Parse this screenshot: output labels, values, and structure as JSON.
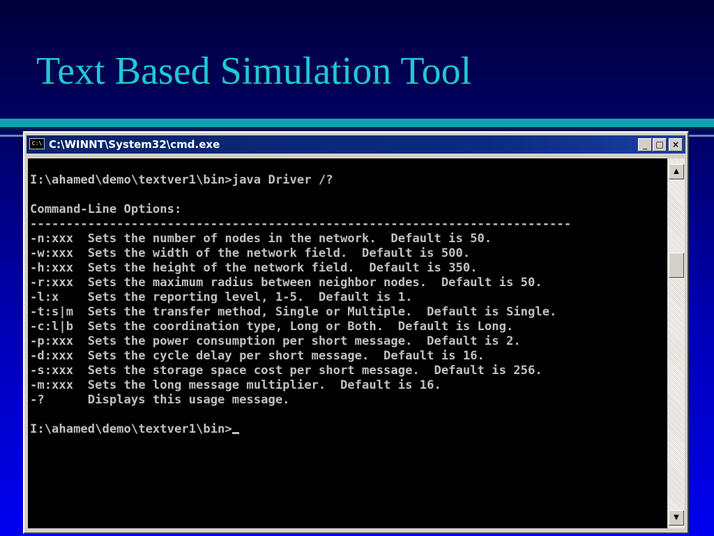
{
  "slide": {
    "title": "Text Based Simulation Tool"
  },
  "window": {
    "title": "C:\\WINNT\\System32\\cmd.exe",
    "controls": {
      "minimize": "_",
      "maximize": "□",
      "close": "×"
    }
  },
  "console": {
    "lines": [
      "",
      "I:\\ahamed\\demo\\textver1\\bin>java Driver /?",
      "",
      "Command-Line Options:",
      "---------------------------------------------------------------------------",
      "-n:xxx  Sets the number of nodes in the network.  Default is 50.",
      "-w:xxx  Sets the width of the network field.  Default is 500.",
      "-h:xxx  Sets the height of the network field.  Default is 350.",
      "-r:xxx  Sets the maximum radius between neighbor nodes.  Default is 50.",
      "-l:x    Sets the reporting level, 1-5.  Default is 1.",
      "-t:s|m  Sets the transfer method, Single or Multiple.  Default is Single.",
      "-c:l|b  Sets the coordination type, Long or Both.  Default is Long.",
      "-p:xxx  Sets the power consumption per short message.  Default is 2.",
      "-d:xxx  Sets the cycle delay per short message.  Default is 16.",
      "-s:xxx  Sets the storage space cost per short message.  Default is 256.",
      "-m:xxx  Sets the long message multiplier.  Default is 16.",
      "-?      Displays this usage message.",
      "",
      "I:\\ahamed\\demo\\textver1\\bin>"
    ]
  },
  "scrollbar": {
    "up_arrow": "▲",
    "down_arrow": "▼",
    "position": 0.27
  }
}
